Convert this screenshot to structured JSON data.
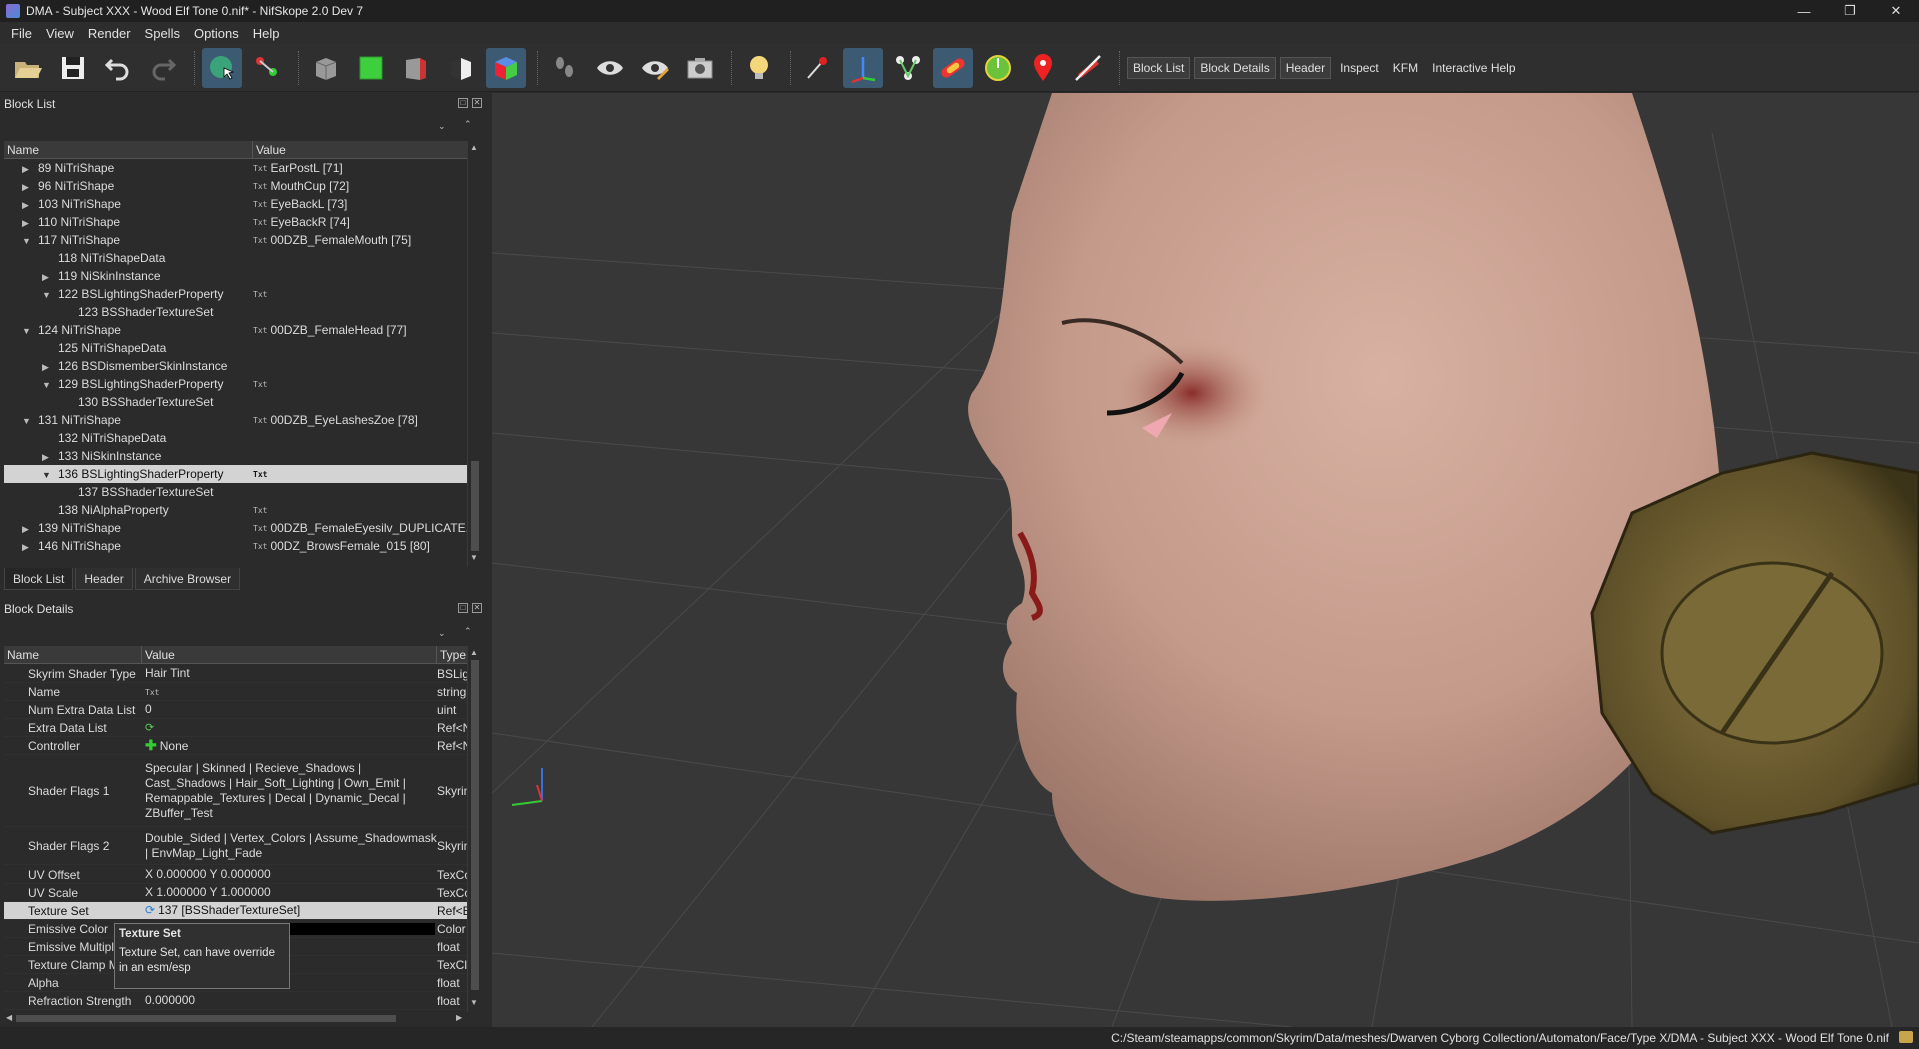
{
  "window": {
    "title": "DMA - Subject XXX - Wood Elf Tone 0.nif* - NifSkope 2.0 Dev 7",
    "min_icon": "minimize-icon",
    "max_icon": "restore-icon",
    "close_icon": "close-icon"
  },
  "menu": [
    "File",
    "View",
    "Render",
    "Spells",
    "Options",
    "Help"
  ],
  "toolbar": {
    "text_buttons": [
      "Block List",
      "Block Details",
      "Header",
      "Inspect",
      "KFM",
      "Interactive Help"
    ]
  },
  "block_list": {
    "title": "Block List",
    "col_name": "Name",
    "col_value": "Value",
    "rows": [
      {
        "name": "89 NiTriShape",
        "value": "EarPostL [71]",
        "tx": "Txt"
      },
      {
        "name": "96 NiTriShape",
        "value": "MouthCup [72]",
        "tx": "Txt"
      },
      {
        "name": "103 NiTriShape",
        "value": "EyeBackL [73]",
        "tx": "Txt"
      },
      {
        "name": "110 NiTriShape",
        "value": "EyeBackR [74]",
        "tx": "Txt"
      },
      {
        "name": "117 NiTriShape",
        "value": "00DZB_FemaleMouth [75]",
        "tx": "Txt"
      },
      {
        "name": "118 NiTriShapeData",
        "value": "",
        "tx": ""
      },
      {
        "name": "119 NiSkinInstance",
        "value": "",
        "tx": ""
      },
      {
        "name": "122 BSLightingShaderProperty",
        "value": "",
        "tx": "Txt"
      },
      {
        "name": "123 BSShaderTextureSet",
        "value": "",
        "tx": ""
      },
      {
        "name": "124 NiTriShape",
        "value": "00DZB_FemaleHead [77]",
        "tx": "Txt"
      },
      {
        "name": "125 NiTriShapeData",
        "value": "",
        "tx": ""
      },
      {
        "name": "126 BSDismemberSkinInstance",
        "value": "",
        "tx": ""
      },
      {
        "name": "129 BSLightingShaderProperty",
        "value": "",
        "tx": "Txt"
      },
      {
        "name": "130 BSShaderTextureSet",
        "value": "",
        "tx": ""
      },
      {
        "name": "131 NiTriShape",
        "value": "00DZB_EyeLashesZoe [78]",
        "tx": "Txt"
      },
      {
        "name": "132 NiTriShapeData",
        "value": "",
        "tx": ""
      },
      {
        "name": "133 NiSkinInstance",
        "value": "",
        "tx": ""
      },
      {
        "name": "136 BSLightingShaderProperty",
        "value": "",
        "tx": "Txt"
      },
      {
        "name": "137 BSShaderTextureSet",
        "value": "",
        "tx": ""
      },
      {
        "name": "138 NiAlphaProperty",
        "value": "",
        "tx": "Txt"
      },
      {
        "name": "139 NiTriShape",
        "value": "00DZB_FemaleEyesilv_DUPLICATE...",
        "tx": "Txt"
      },
      {
        "name": "146 NiTriShape",
        "value": "00DZ_BrowsFemale_015 [80]",
        "tx": "Txt"
      }
    ],
    "tabs": [
      "Block List",
      "Header",
      "Archive Browser"
    ]
  },
  "block_details": {
    "title": "Block Details",
    "col_name": "Name",
    "col_value": "Value",
    "col_type": "Type",
    "rows": [
      {
        "name": "Skyrim Shader Type",
        "value": "Hair Tint",
        "type": "BSLig"
      },
      {
        "name": "Name",
        "value": "Txt",
        "type": "string"
      },
      {
        "name": "Num Extra Data List",
        "value": "0",
        "type": "uint"
      },
      {
        "name": "Extra Data List",
        "value": "",
        "type": "Ref<N"
      },
      {
        "name": "Controller",
        "value": "None",
        "type": "Ref<N"
      },
      {
        "name": "Shader Flags 1",
        "value": "Specular | Skinned | Recieve_Shadows | Cast_Shadows | Hair_Soft_Lighting | Own_Emit | Remappable_Textures | Decal | Dynamic_Decal | ZBuffer_Test",
        "type": "Skyrin"
      },
      {
        "name": "Shader Flags 2",
        "value": "Double_Sided | Vertex_Colors | Assume_Shadowmask | EnvMap_Light_Fade",
        "type": "Skyrin"
      },
      {
        "name": "UV Offset",
        "value": "X 0.000000 Y 0.000000",
        "type": "TexCo"
      },
      {
        "name": "UV Scale",
        "value": "X 1.000000 Y 1.000000",
        "type": "TexCo"
      },
      {
        "name": "Texture Set",
        "value": "137 [BSShaderTextureSet]",
        "type": "Ref<B"
      },
      {
        "name": "Emissive Color",
        "value": "",
        "type": "Color"
      },
      {
        "name": "Emissive Multipl",
        "value": "",
        "type": "float"
      },
      {
        "name": "Texture Clamp M",
        "value": "",
        "type": "TexCl"
      },
      {
        "name": "Alpha",
        "value": "",
        "type": "float"
      },
      {
        "name": "Refraction Strength",
        "value": "0.000000",
        "type": "float"
      }
    ],
    "tooltip_title": "Texture Set",
    "tooltip_text": "Texture Set, can have override in an esm/esp"
  },
  "status": {
    "path": "C:/Steam/steamapps/common/Skyrim/Data/meshes/Dwarven Cyborg Collection/Automaton/Face/Type X/DMA - Subject XXX - Wood Elf Tone 0.nif"
  },
  "colors": {
    "viewport_bg": "#373737",
    "selection": "#d3d3d3",
    "skin": "#c9a292"
  }
}
